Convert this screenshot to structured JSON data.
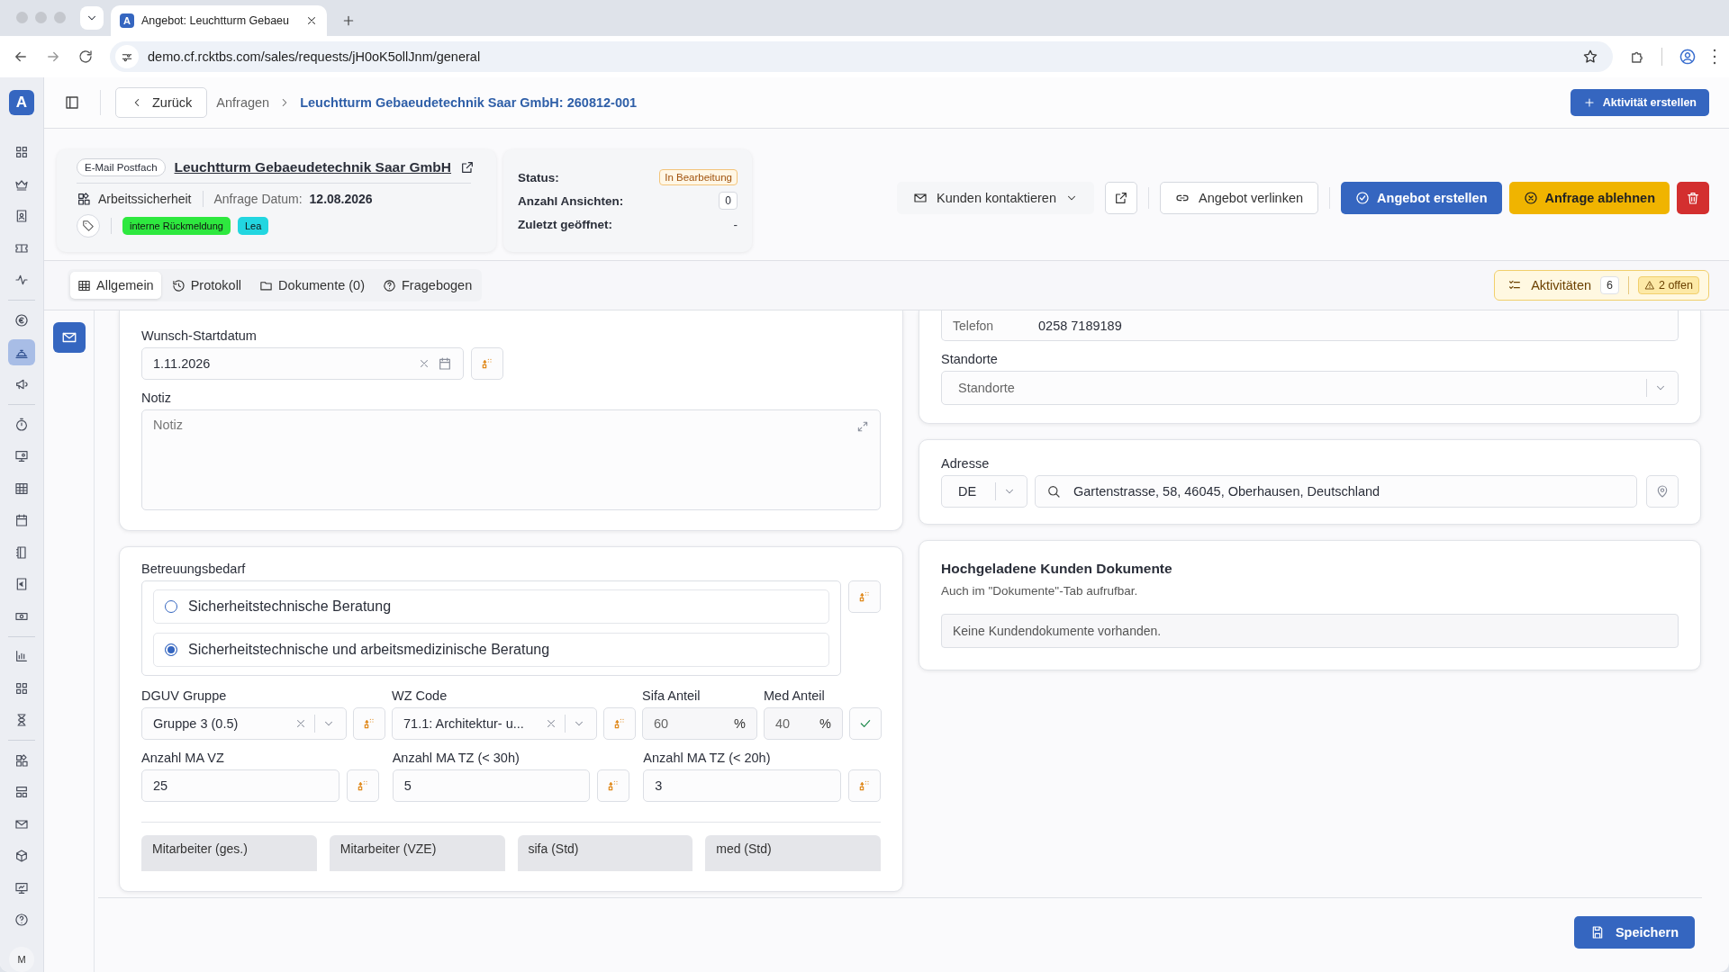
{
  "browser": {
    "tab_favicon": "A",
    "tab_title": "Angebot: Leuchtturm Gebaeu",
    "url": "demo.cf.rcktbs.com/sales/requests/jH0oK5ollJnm/general"
  },
  "sidebar": {
    "logo": "A",
    "avatar": "M",
    "groups": [
      {
        "items": [
          {
            "selected": false
          },
          {
            "selected": false
          },
          {
            "selected": false
          },
          {
            "selected": false
          },
          {
            "selected": false
          }
        ]
      },
      {
        "items": [
          {
            "selected": false
          },
          {
            "selected": true
          },
          {
            "selected": false
          }
        ]
      },
      {
        "items": [
          {
            "selected": false
          },
          {
            "selected": false
          },
          {
            "selected": false
          },
          {
            "selected": false
          },
          {
            "selected": false
          },
          {
            "selected": false
          },
          {
            "selected": false
          }
        ]
      },
      {
        "items": [
          {
            "selected": false
          },
          {
            "selected": false
          },
          {
            "selected": false
          }
        ]
      },
      {
        "items": [
          {
            "selected": false
          },
          {
            "selected": false
          },
          {
            "selected": false
          },
          {
            "selected": false
          },
          {
            "selected": false
          },
          {
            "selected": false
          }
        ]
      }
    ]
  },
  "header": {
    "back": "Zurück",
    "breadcrumbs": [
      {
        "label": "Anfragen",
        "current": false
      },
      {
        "label": "Leuchtturm Gebaeudetechnik Saar GmbH: 260812-001",
        "current": true
      }
    ],
    "create_activity": "Aktivität erstellen"
  },
  "record": {
    "source": "E-Mail Postfach",
    "company": "Leuchtturm Gebaeudetechnik Saar GmbH",
    "category": "Arbeitssicherheit",
    "date_label": "Anfrage Datum:",
    "date": "12.08.2026",
    "tags": [
      {
        "label": "interne Rückmeldung",
        "color": "#2ee83f"
      },
      {
        "label": "Lea",
        "color": "#22d6e0"
      }
    ]
  },
  "status": [
    {
      "label": "Status:",
      "value": "In Bearbeitung",
      "kind": "badge"
    },
    {
      "label": "Anzahl Ansichten:",
      "value": "0",
      "kind": "count"
    },
    {
      "label": "Zuletzt geöffnet:",
      "value": "-",
      "kind": "text"
    }
  ],
  "actions": {
    "contact": "Kunden kontaktieren",
    "link_offer": "Angebot verlinken",
    "create_offer": "Angebot erstellen",
    "decline": "Anfrage ablehnen"
  },
  "tabs": [
    {
      "label": "Allgemein",
      "selected": true
    },
    {
      "label": "Protokoll",
      "selected": false
    },
    {
      "label": "Dokumente (0)",
      "selected": false
    },
    {
      "label": "Fragebogen",
      "selected": false
    }
  ],
  "activities": {
    "label": "Aktivitäten",
    "count": "6",
    "open": "2 offen"
  },
  "form": {
    "start_date": {
      "label": "Wunsch-Startdatum",
      "value": "1.11.2026"
    },
    "note": {
      "label": "Notiz",
      "placeholder": "Notiz"
    },
    "care": {
      "label": "Betreuungsbedarf",
      "options": [
        {
          "label": "Sicherheitstechnische Beratung",
          "selected": false
        },
        {
          "label": "Sicherheitstechnische und arbeitsmedizinische Beratung",
          "selected": true
        }
      ]
    },
    "dguv": {
      "label": "DGUV Gruppe",
      "value": "Gruppe 3 (0.5)"
    },
    "wz": {
      "label": "WZ Code",
      "value": "71.1: Architektur- u..."
    },
    "sifa": {
      "label": "Sifa Anteil",
      "value": "60",
      "unit": "%"
    },
    "med": {
      "label": "Med Anteil",
      "value": "40",
      "unit": "%"
    },
    "counts": [
      {
        "label": "Anzahl MA VZ",
        "value": "25"
      },
      {
        "label": "Anzahl MA TZ (< 30h)",
        "value": "5"
      },
      {
        "label": "Anzahl MA TZ (< 20h)",
        "value": "3"
      }
    ],
    "tiles": [
      "Mitarbeiter (ges.)",
      "Mitarbeiter (VZE)",
      "sifa (Std)",
      "med (Std)"
    ]
  },
  "contact": {
    "phone_label": "Telefon",
    "phone": "0258 7189189",
    "locations": {
      "label": "Standorte",
      "placeholder": "Standorte"
    }
  },
  "address": {
    "label": "Adresse",
    "country": "DE",
    "value": "Gartenstrasse, 58, 46045, Oberhausen, Deutschland"
  },
  "documents": {
    "title": "Hochgeladene Kunden Dokumente",
    "hint": "Auch im \"Dokumente\"-Tab aufrufbar.",
    "empty": "Keine Kundendokumente vorhanden."
  },
  "footer": {
    "save": "Speichern"
  }
}
